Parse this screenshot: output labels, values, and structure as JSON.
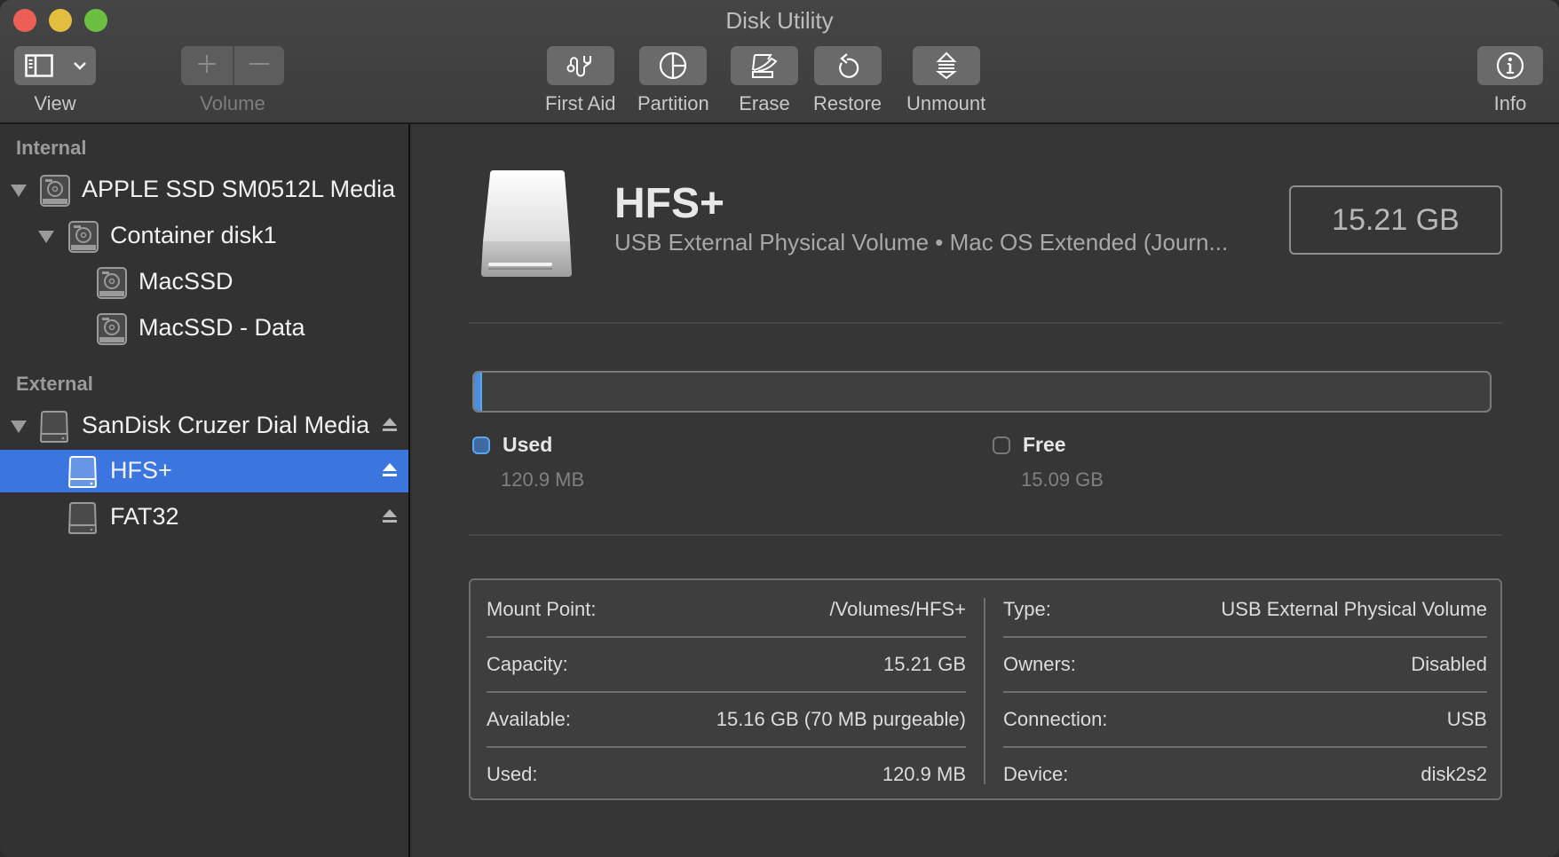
{
  "window": {
    "title": "Disk Utility"
  },
  "toolbar": {
    "view": {
      "label": "View",
      "icon": "sidebar-icon",
      "menu_icon": "chevron-down-icon"
    },
    "volume": {
      "label": "Volume",
      "add_icon": "plus-icon",
      "remove_icon": "minus-icon",
      "disabled": true
    },
    "first_aid": {
      "label": "First Aid",
      "icon": "stethoscope-icon"
    },
    "partition": {
      "label": "Partition",
      "icon": "pie-chart-icon"
    },
    "erase": {
      "label": "Erase",
      "icon": "erase-icon"
    },
    "restore": {
      "label": "Restore",
      "icon": "restore-icon"
    },
    "unmount": {
      "label": "Unmount",
      "icon": "unmount-icon"
    },
    "info": {
      "label": "Info",
      "icon": "info-icon"
    }
  },
  "sidebar": {
    "sections": [
      {
        "title": "Internal",
        "items": [
          {
            "label": "APPLE SSD SM0512L Media",
            "icon": "internal-disk-icon",
            "expanded": true,
            "level": 0
          },
          {
            "label": "Container disk1",
            "icon": "internal-disk-icon",
            "expanded": true,
            "level": 1
          },
          {
            "label": "MacSSD",
            "icon": "internal-disk-icon",
            "level": 2
          },
          {
            "label": "MacSSD - Data",
            "icon": "internal-disk-icon",
            "level": 2
          }
        ]
      },
      {
        "title": "External",
        "items": [
          {
            "label": "SanDisk Cruzer Dial Media",
            "icon": "external-disk-icon",
            "expanded": true,
            "level": 0,
            "eject": true
          },
          {
            "label": "HFS+",
            "icon": "external-disk-icon",
            "level": 1,
            "eject": true,
            "selected": true
          },
          {
            "label": "FAT32",
            "icon": "external-disk-icon",
            "level": 1,
            "eject": true
          }
        ]
      }
    ]
  },
  "volume": {
    "name": "HFS+",
    "subtitle": "USB External Physical Volume • Mac OS Extended (Journ...",
    "size": "15.21 GB",
    "usage_fraction": 0.008,
    "used": {
      "label": "Used",
      "value": "120.9 MB",
      "color": "#4c8fd8"
    },
    "free": {
      "label": "Free",
      "value": "15.09 GB"
    }
  },
  "details": {
    "left": [
      {
        "key": "Mount Point:",
        "value": "/Volumes/HFS+"
      },
      {
        "key": "Capacity:",
        "value": "15.21 GB"
      },
      {
        "key": "Available:",
        "value": "15.16 GB (70 MB purgeable)"
      },
      {
        "key": "Used:",
        "value": "120.9 MB"
      }
    ],
    "right": [
      {
        "key": "Type:",
        "value": "USB External Physical Volume"
      },
      {
        "key": "Owners:",
        "value": "Disabled"
      },
      {
        "key": "Connection:",
        "value": "USB"
      },
      {
        "key": "Device:",
        "value": "disk2s2"
      }
    ]
  },
  "colors": {
    "selection": "#3a75e0",
    "close": "#ec5f57",
    "minimize": "#e2bf3f",
    "maximize": "#6bc041"
  }
}
